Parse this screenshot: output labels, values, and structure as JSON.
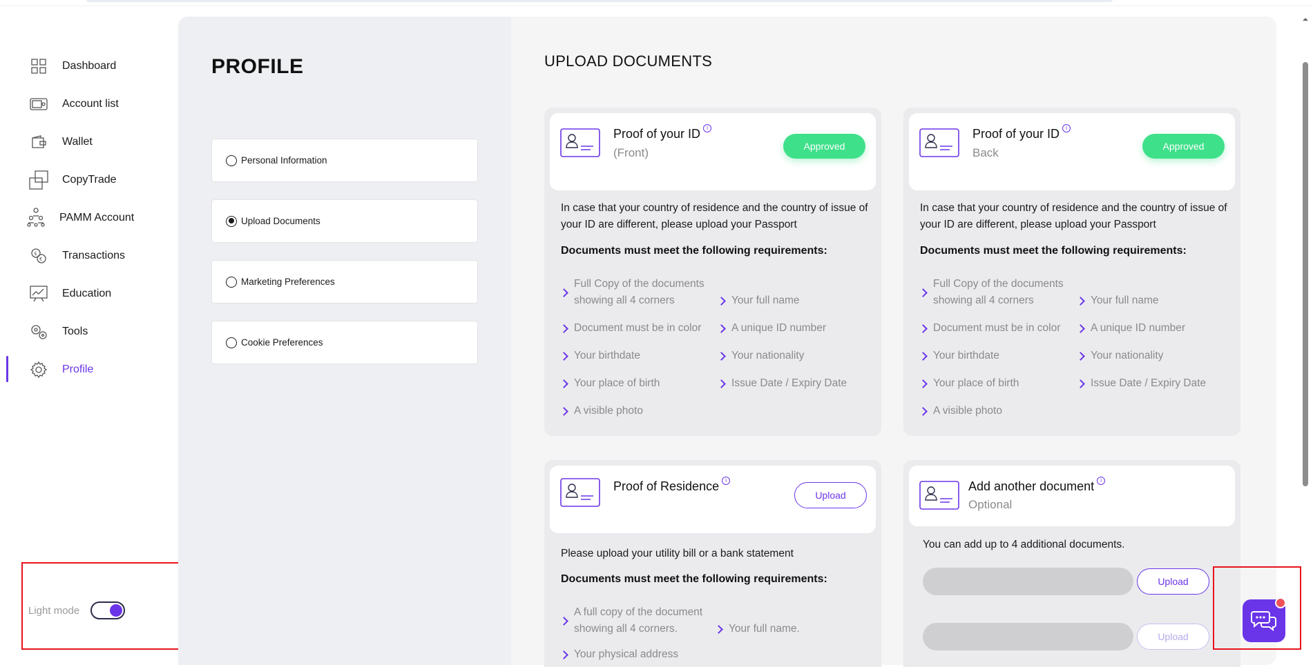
{
  "sidebar": {
    "items": [
      {
        "label": "Dashboard",
        "icon": "dashboard-icon"
      },
      {
        "label": "Account list",
        "icon": "account-list-icon"
      },
      {
        "label": "Wallet",
        "icon": "wallet-icon"
      },
      {
        "label": "CopyTrade",
        "icon": "copytrade-icon"
      },
      {
        "label": "PAMM Account",
        "icon": "pamm-icon"
      },
      {
        "label": "Transactions",
        "icon": "transactions-icon"
      },
      {
        "label": "Education",
        "icon": "education-icon"
      },
      {
        "label": "Tools",
        "icon": "tools-icon"
      },
      {
        "label": "Profile",
        "icon": "profile-gear-icon"
      }
    ],
    "active": "Profile",
    "light_mode_label": "Light mode",
    "light_mode_on": true
  },
  "profile": {
    "title": "PROFILE",
    "menu": [
      {
        "label": "Personal Information",
        "selected": false
      },
      {
        "label": "Upload Documents",
        "selected": true
      },
      {
        "label": "Marketing Preferences",
        "selected": false
      },
      {
        "label": "Cookie Preferences",
        "selected": false
      }
    ]
  },
  "upload": {
    "title": "UPLOAD DOCUMENTS",
    "id_front": {
      "title": "Proof of your ID",
      "subtitle": "(Front)",
      "status": "Approved",
      "description": "In case that your country of residence and the country of issue of your ID are different, please upload your Passport",
      "requirements_heading": "Documents must meet the following requirements:",
      "requirements_left": [
        "Full Copy of the documents showing all 4 corners",
        "Document must be in color",
        "Your birthdate",
        "Your place of birth",
        "A visible photo"
      ],
      "requirements_right": [
        "Your full name",
        "A unique ID number",
        "Your nationality",
        "Issue Date / Expiry Date"
      ]
    },
    "id_back": {
      "title": "Proof of your ID",
      "subtitle": "Back",
      "status": "Approved",
      "description": "In case that your country of residence and the country of issue of your ID are different, please upload your Passport",
      "requirements_heading": "Documents must meet the following requirements:",
      "requirements_left": [
        "Full Copy of the documents showing all 4 corners",
        "Document must be in color",
        "Your birthdate",
        "Your place of birth",
        "A visible photo"
      ],
      "requirements_right": [
        "Your full name",
        "A unique ID number",
        "Your nationality",
        "Issue Date / Expiry Date"
      ]
    },
    "residence": {
      "title": "Proof of Residence",
      "button": "Upload",
      "description": "Please upload your utility bill or a bank statement",
      "requirements_heading": "Documents must meet the following requirements:",
      "requirements_left": [
        "A full copy of the document showing all 4 corners.",
        "Your physical address"
      ],
      "requirements_right": [
        "Your full name."
      ]
    },
    "another": {
      "title": "Add another document",
      "subtitle": "Optional",
      "description": "You can add up to 4 additional documents.",
      "button1": "Upload",
      "button2": "Upload"
    }
  },
  "colors": {
    "accent": "#6a35e8",
    "approved": "#3ee08a",
    "panel": "#eeeff2",
    "chat_notification": "#f0525a"
  }
}
